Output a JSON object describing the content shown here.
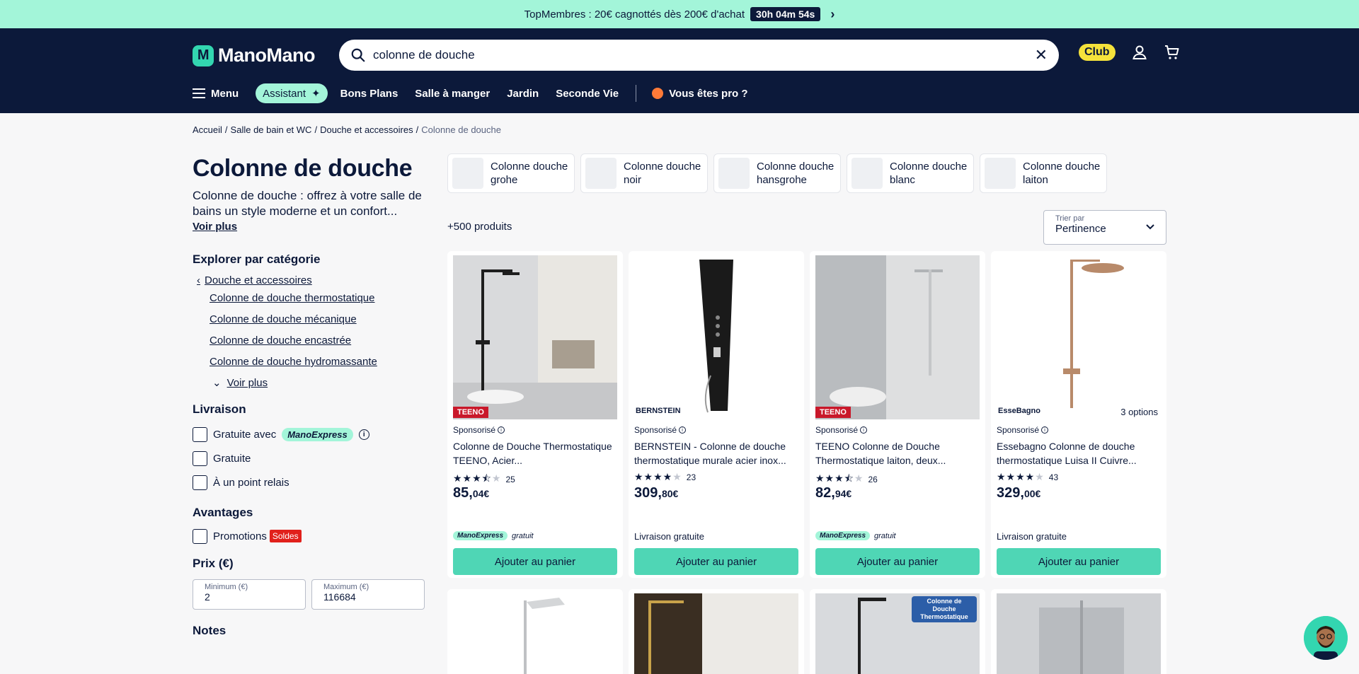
{
  "promo": {
    "text": "TopMembres : 20€ cagnottés dès 200€ d'achat",
    "timer": "30h 04m 54s"
  },
  "header": {
    "logo": "ManoMano",
    "search_value": "colonne de douche",
    "club": "Club",
    "nav": [
      "Menu",
      "Assistant",
      "Bons Plans",
      "Salle à manger",
      "Jardin",
      "Seconde Vie",
      "Vous êtes pro ?"
    ]
  },
  "breadcrumb": [
    "Accueil",
    "Salle de bain et WC",
    "Douche et accessoires",
    "Colonne de douche"
  ],
  "sidebar": {
    "title": "Colonne de douche",
    "description": "Colonne de douche : offrez à votre salle de bains un style moderne et un confort...",
    "voir_plus": "Voir plus",
    "explore_title": "Explorer par catégorie",
    "parent_category": "Douche et accessoires",
    "categories": [
      "Colonne de douche thermostatique",
      "Colonne de douche mécanique",
      "Colonne de douche encastrée",
      "Colonne de douche hydromassante"
    ],
    "categories_more": "Voir plus",
    "delivery_title": "Livraison",
    "delivery_options": [
      "Gratuite avec",
      "Gratuite",
      "À un point relais"
    ],
    "manoexpress": "ManoExpress",
    "advantages_title": "Avantages",
    "promotions": "Promotions",
    "soldes": "Soldes",
    "price_title": "Prix (€)",
    "price_min_label": "Minimum (€)",
    "price_min": "2",
    "price_max_label": "Maximum (€)",
    "price_max": "116684",
    "notes_title": "Notes"
  },
  "chips": [
    "Colonne douche grohe",
    "Colonne douche noir",
    "Colonne douche hansgrohe",
    "Colonne douche blanc",
    "Colonne douche laiton"
  ],
  "results": {
    "count": "+500 produits",
    "sort_label": "Trier par",
    "sort_value": "Pertinence"
  },
  "products": [
    {
      "brand": "TEENO",
      "sponsored": "Sponsorisé",
      "title": "Colonne de Douche Thermostatique TEENO, Acier...",
      "rating": 3.5,
      "reviews": "25",
      "price_int": "85,",
      "price_dec": "04€",
      "shipping": "ManoExpress",
      "shipping_suffix": "gratuit",
      "button": "Ajouter au panier"
    },
    {
      "brand": "BERNSTEIN",
      "sponsored": "Sponsorisé",
      "title": "BERNSTEIN - Colonne de douche thermostatique murale acier inox...",
      "rating": 4,
      "reviews": "23",
      "price_int": "309,",
      "price_dec": "80€",
      "shipping": "Livraison gratuite",
      "button": "Ajouter au panier"
    },
    {
      "brand": "TEENO",
      "sponsored": "Sponsorisé",
      "title": "TEENO Colonne de Douche Thermostatique laiton, deux...",
      "rating": 3.5,
      "reviews": "26",
      "price_int": "82,",
      "price_dec": "94€",
      "shipping": "ManoExpress",
      "shipping_suffix": "gratuit",
      "button": "Ajouter au panier"
    },
    {
      "brand": "EsseBagno",
      "options": "3 options",
      "sponsored": "Sponsorisé",
      "title": "Essebagno Colonne de douche thermostatique Luisa II Cuivre...",
      "rating": 4,
      "reviews": "43",
      "price_int": "329,",
      "price_dec": "00€",
      "shipping": "Livraison gratuite",
      "button": "Ajouter au panier"
    }
  ],
  "second_row_badge": "Colonne de Douche Thermostatique"
}
